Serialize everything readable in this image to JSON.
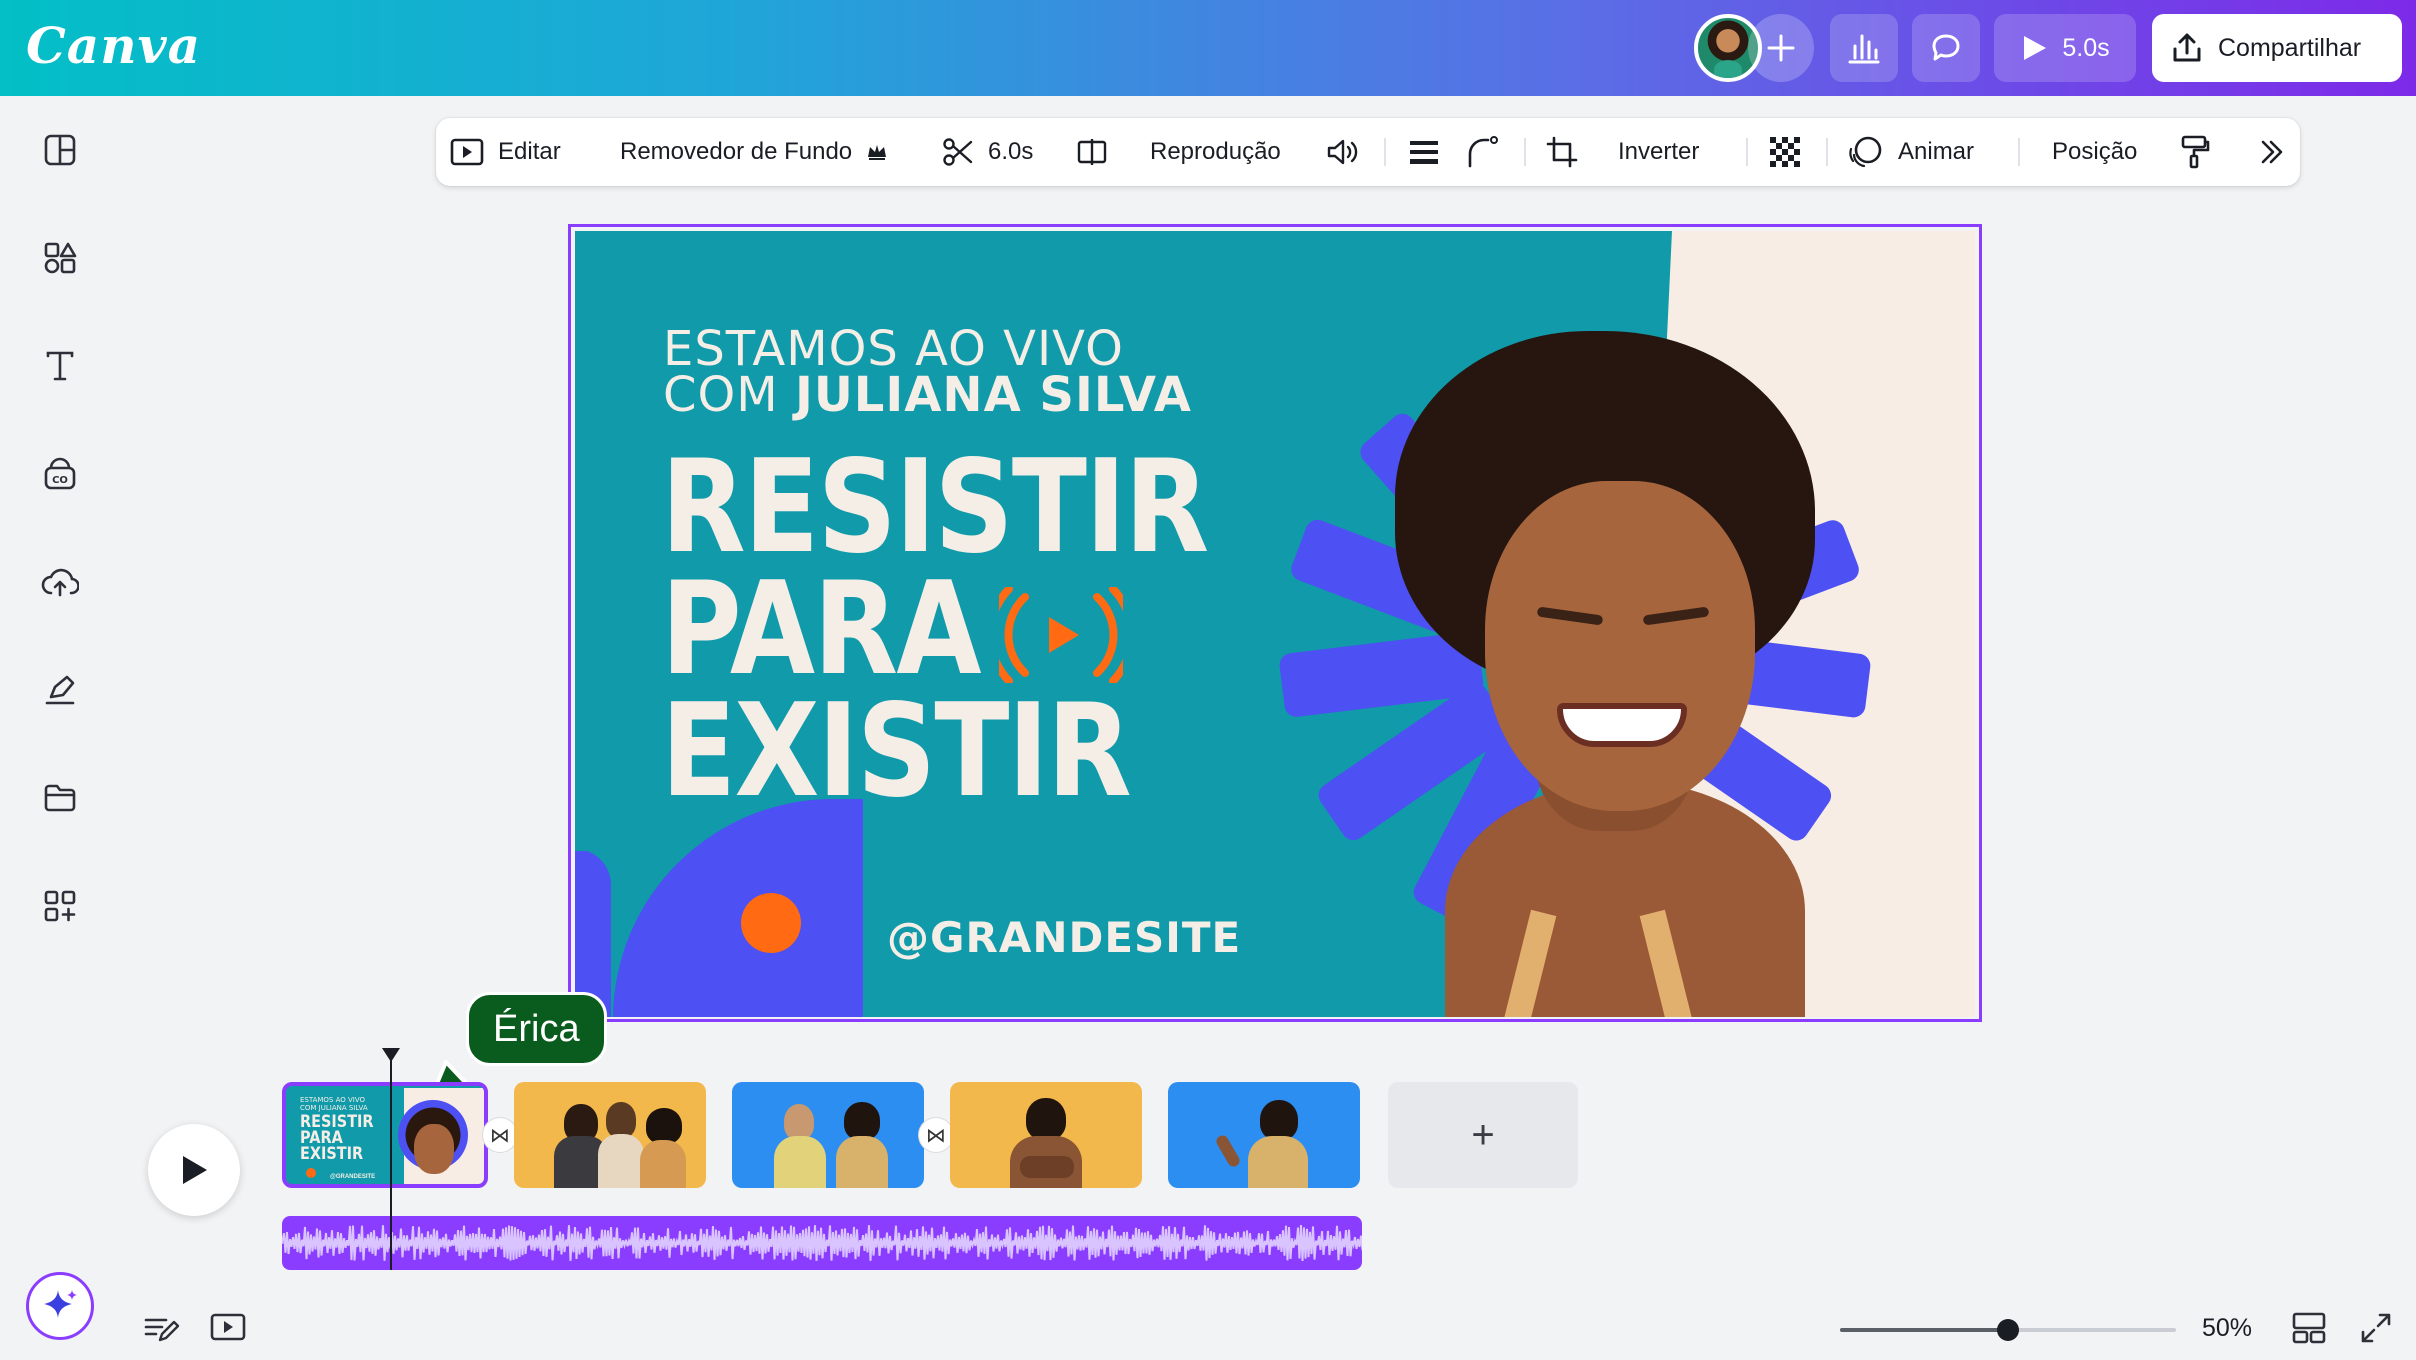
{
  "app": {
    "logo": "Canva"
  },
  "header": {
    "present_duration": "5.0s",
    "share_label": "Compartilhar",
    "add_icon": "plus-icon",
    "insights_icon": "bar-chart-icon",
    "comment_icon": "speech-bubble-icon"
  },
  "left_rail": {
    "icons": [
      "layout-icon",
      "elements-icon",
      "text-icon",
      "brand-icon",
      "upload-cloud-icon",
      "draw-icon",
      "folder-icon",
      "apps-icon"
    ]
  },
  "toolbar": {
    "edit": "Editar",
    "bg_remover": "Removedor de Fundo",
    "duration": "6.0s",
    "playback": "Reprodução",
    "flip": "Inverter",
    "animate": "Animar",
    "position": "Posição"
  },
  "design": {
    "line1": "ESTAMOS AO VIVO",
    "line2_prefix": "COM ",
    "line2_name": "JULIANA SILVA",
    "title_line1": "RESISTIR",
    "title_line2": "PARA",
    "title_line3": "EXISTIR",
    "handle": "@GRANDESITE",
    "colors": {
      "teal": "#119aa9",
      "cream": "#f7ede4",
      "blue": "#4d50f2",
      "orange": "#ff6a13"
    }
  },
  "collaborator": {
    "name": "Érica",
    "color": "#0a5c1e"
  },
  "timeline": {
    "clip1": {
      "line1": "ESTAMOS AO VIVO",
      "line2": "COM JULIANA SILVA",
      "t1": "RESISTIR",
      "t2": "PARA",
      "t3": "EXISTIR",
      "handle": "@GRANDESITE"
    },
    "add_label": "+",
    "audio_color": "#8b3dff"
  },
  "footer": {
    "zoom_label": "50%",
    "zoom_value": 0.5
  }
}
